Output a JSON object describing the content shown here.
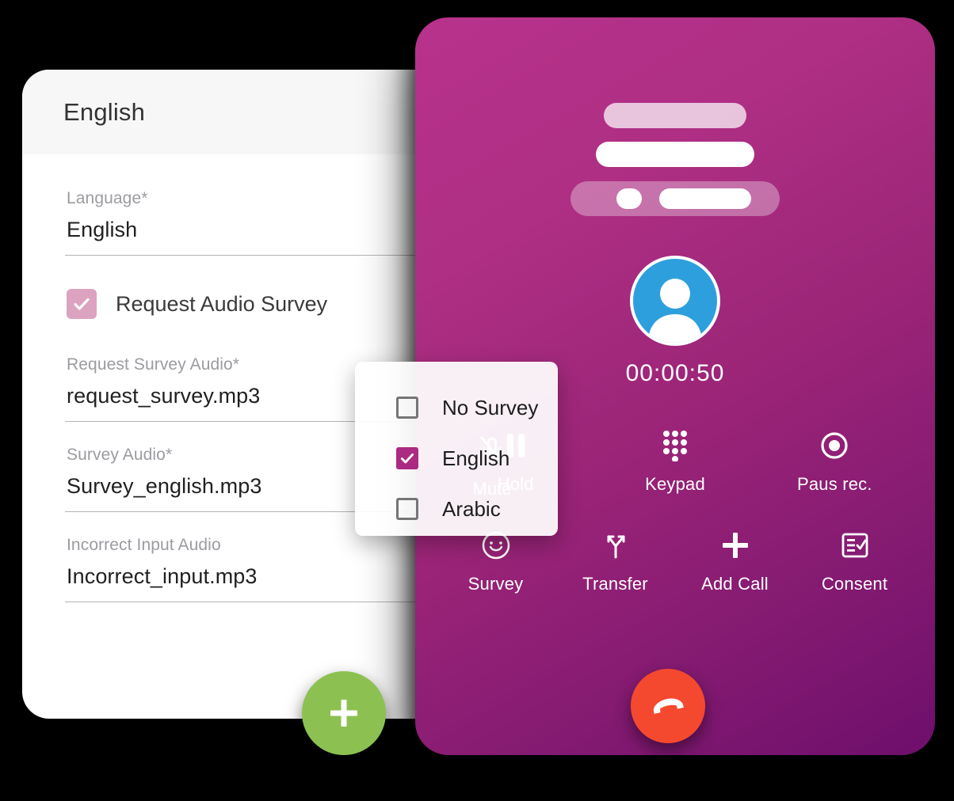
{
  "form_card": {
    "header_title": "English",
    "fields": [
      {
        "label": "Language*",
        "value": "English",
        "name": "language"
      },
      {
        "label": "Request Survey Audio*",
        "value": "request_survey.mp3",
        "name": "request-survey-audio"
      },
      {
        "label": "Survey Audio*",
        "value": "Survey_english.mp3",
        "name": "survey-audio"
      },
      {
        "label": "Incorrect Input Audio",
        "value": "Incorrect_input.mp3",
        "name": "incorrect-input-audio"
      }
    ],
    "checkbox": {
      "label": "Request Audio Survey",
      "checked": true,
      "color": "#dca3c1"
    },
    "add_button": {
      "icon": "plus-icon",
      "color": "#8cc152"
    }
  },
  "dropdown": {
    "options": [
      {
        "label": "No Survey",
        "checked": false
      },
      {
        "label": "English",
        "checked": true
      },
      {
        "label": "Arabic",
        "checked": false
      }
    ],
    "checked_color": "#ab2a82"
  },
  "call_panel": {
    "timer": "00:00:50",
    "avatar": {
      "icon": "person-avatar-icon",
      "color": "#2e9fdd"
    },
    "actions_row_1": [
      {
        "label": "Hold",
        "icon": "pause-icon"
      },
      {
        "label": "Keypad",
        "icon": "dialpad-icon"
      },
      {
        "label": "Paus rec.",
        "icon": "record-pause-icon"
      }
    ],
    "actions_row_2": [
      {
        "label": "Survey",
        "icon": "smiley-icon"
      },
      {
        "label": "Transfer",
        "icon": "transfer-arrows-icon"
      },
      {
        "label": "Add Call",
        "icon": "plus-icon"
      },
      {
        "label": "Consent",
        "icon": "checklist-icon"
      }
    ],
    "mute": {
      "label": "Mute",
      "icon": "mic-off-icon"
    },
    "end_call": {
      "icon": "hangup-phone-icon",
      "color": "#f4492f"
    },
    "gradient_from": "#b8328c",
    "gradient_to": "#6e0f6c"
  }
}
